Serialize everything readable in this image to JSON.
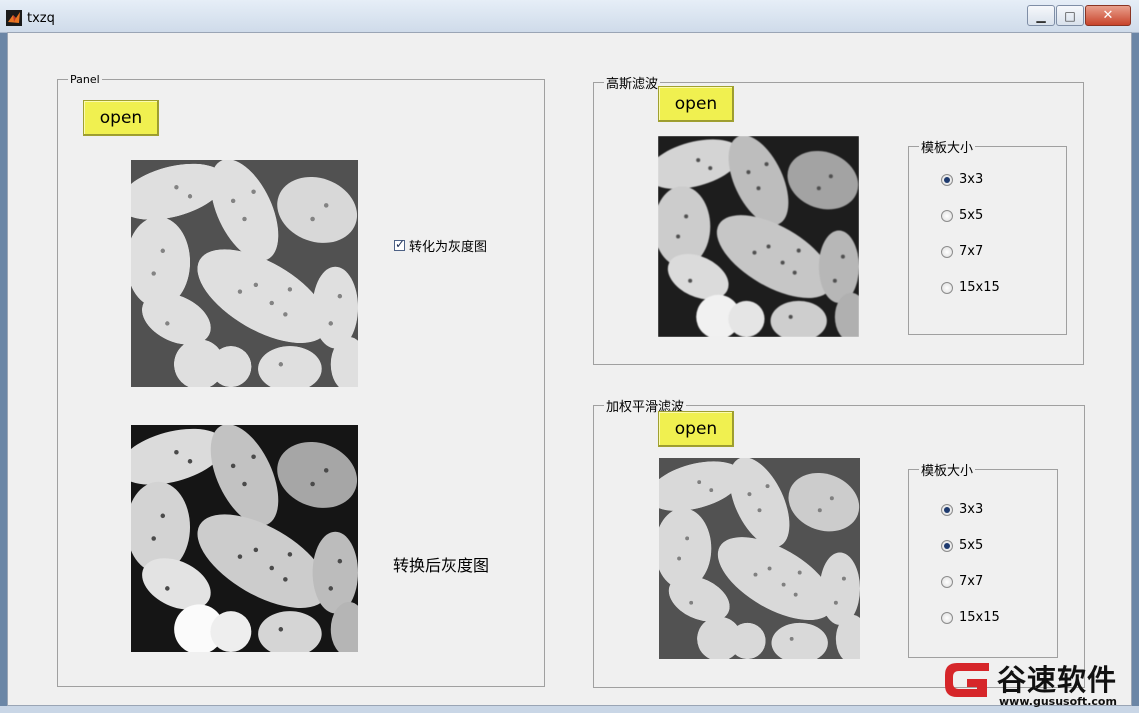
{
  "window": {
    "title": "txzq",
    "minimize_glyph": "▁",
    "maximize_glyph": "□",
    "close_glyph": "✕"
  },
  "left_panel": {
    "legend": "Panel",
    "open_label": "open",
    "checkbox_label": "转化为灰度图",
    "checkbox_checked": true,
    "result_label": "转换后灰度图"
  },
  "gauss_panel": {
    "legend": "高斯滤波",
    "open_label": "open",
    "group_legend": "模板大小",
    "options": [
      {
        "label": "3x3",
        "selected": true
      },
      {
        "label": "5x5",
        "selected": false
      },
      {
        "label": "7x7",
        "selected": false
      },
      {
        "label": "15x15",
        "selected": false
      }
    ]
  },
  "weighted_panel": {
    "legend": "加权平滑滤波",
    "open_label": "open",
    "group_legend": "模板大小",
    "options": [
      {
        "label": "3x3",
        "selected": true
      },
      {
        "label": "5x5",
        "selected": true
      },
      {
        "label": "7x7",
        "selected": false
      },
      {
        "label": "15x15",
        "selected": false
      }
    ]
  },
  "watermark": {
    "name": "谷速软件",
    "url": "www.gususoft.com"
  },
  "colors": {
    "button_yellow": "#f0f050",
    "panel_bg": "#f0f0f0",
    "radio_dot": "#1e3a6e"
  }
}
